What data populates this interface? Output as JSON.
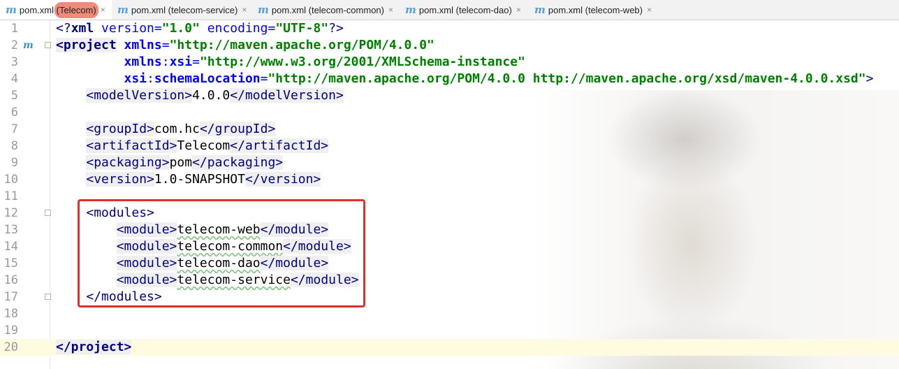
{
  "tabs": [
    {
      "prefix": "pom.xml",
      "project": "(Telecom)",
      "close": "×",
      "active": true
    },
    {
      "prefix": "pom.xml",
      "project": "(telecom-service)",
      "close": "×",
      "active": false
    },
    {
      "prefix": "pom.xml",
      "project": "(telecom-common)",
      "close": "×",
      "active": false
    },
    {
      "prefix": "pom.xml",
      "project": "(telecom-dao)",
      "close": "×",
      "active": false
    },
    {
      "prefix": "pom.xml",
      "project": "(telecom-web)",
      "close": "×",
      "active": false
    }
  ],
  "tab_icon_glyph": "m",
  "gutter_marker": "m",
  "line_numbers": [
    "1",
    "2",
    "3",
    "4",
    "5",
    "6",
    "7",
    "8",
    "9",
    "10",
    "11",
    "12",
    "13",
    "14",
    "15",
    "16",
    "17",
    "18",
    "19",
    "20"
  ],
  "code": {
    "l1": {
      "open": "<?",
      "name": "xml",
      "a1": " version",
      "eq1": "=",
      "v1": "\"1.0\"",
      "a2": " encoding",
      "eq2": "=",
      "v2": "\"UTF-8\"",
      "close": "?>"
    },
    "l2": {
      "open": "<project",
      "attr": "xmlns",
      "eq": "=",
      "val": "\"http://maven.apache.org/POM/4.0.0\""
    },
    "l3": {
      "attr_ns": "xmlns",
      "colon": ":",
      "attr": "xsi",
      "eq": "=",
      "val": "\"http://www.w3.org/2001/XMLSchema-instance\""
    },
    "l4": {
      "attr_ns": "xsi",
      "colon": ":",
      "attr": "schemaLocation",
      "eq": "=",
      "val": "\"http://maven.apache.org/POM/4.0.0 http://maven.apache.org/xsd/maven-4.0.0.xsd\"",
      "close": ">"
    },
    "l5": {
      "open": "<modelVersion>",
      "text": "4.0.0",
      "close": "</modelVersion>"
    },
    "l7": {
      "open": "<groupId>",
      "text": "com.hc",
      "close": "</groupId>"
    },
    "l8": {
      "open": "<artifactId>",
      "text": "Telecom",
      "close": "</artifactId>"
    },
    "l9": {
      "open": "<packaging>",
      "text": "pom",
      "close": "</packaging>"
    },
    "l10": {
      "open": "<version>",
      "text": "1.0-SNAPSHOT",
      "close": "</version>"
    },
    "l12": {
      "open": "<modules>"
    },
    "l13": {
      "open": "<module>",
      "text": "telecom-web",
      "close": "</module>"
    },
    "l14": {
      "open": "<module>",
      "text": "telecom-common",
      "close": "</module>"
    },
    "l15": {
      "open": "<module>",
      "text": "telecom-dao",
      "close": "</module>"
    },
    "l16": {
      "open": "<module>",
      "text": "telecom-service",
      "close": "</module>"
    },
    "l17": {
      "close": "</modules>"
    },
    "l20": {
      "close": "</project>"
    }
  },
  "colors": {
    "tag": "#000080",
    "attribute": "#0000ff",
    "value": "#008000",
    "highlight_box": "#e0302e",
    "caret_line": "#fffbe0"
  }
}
